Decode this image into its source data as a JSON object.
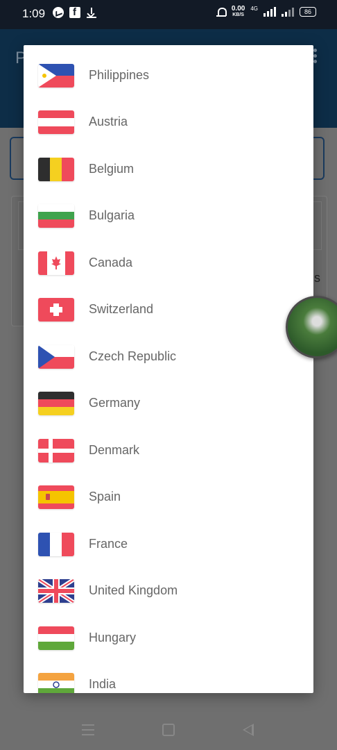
{
  "status_bar": {
    "time": "1:09",
    "net_speed": "0.00",
    "net_unit": "KB/S",
    "network_type": "4G",
    "battery": "86"
  },
  "background_app": {
    "title_initial": "P",
    "card_text": "s"
  },
  "dialog": {
    "countries": [
      {
        "name": "Philippines",
        "flag_icon": "philippines-flag-icon"
      },
      {
        "name": "Austria",
        "flag_icon": "austria-flag-icon"
      },
      {
        "name": "Belgium",
        "flag_icon": "belgium-flag-icon"
      },
      {
        "name": "Bulgaria",
        "flag_icon": "bulgaria-flag-icon"
      },
      {
        "name": "Canada",
        "flag_icon": "canada-flag-icon"
      },
      {
        "name": "Switzerland",
        "flag_icon": "switzerland-flag-icon"
      },
      {
        "name": "Czech Republic",
        "flag_icon": "czech-republic-flag-icon"
      },
      {
        "name": "Germany",
        "flag_icon": "germany-flag-icon"
      },
      {
        "name": "Denmark",
        "flag_icon": "denmark-flag-icon"
      },
      {
        "name": "Spain",
        "flag_icon": "spain-flag-icon"
      },
      {
        "name": "France",
        "flag_icon": "france-flag-icon"
      },
      {
        "name": "United Kingdom",
        "flag_icon": "united-kingdom-flag-icon"
      },
      {
        "name": "Hungary",
        "flag_icon": "hungary-flag-icon"
      },
      {
        "name": "India",
        "flag_icon": "india-flag-icon"
      }
    ]
  },
  "colors": {
    "header_bg": "#0d2d47",
    "status_bar_bg": "#121a26",
    "scrim": "#6f6f6f",
    "dialog_bg": "#ffffff",
    "country_text": "#666666"
  }
}
